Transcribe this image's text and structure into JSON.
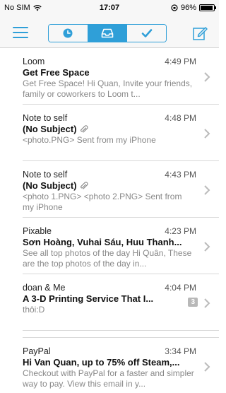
{
  "status": {
    "carrier": "No SIM",
    "time": "17:07",
    "battery": "96%",
    "battery_level": 0.96
  },
  "nav": {
    "tabs": [
      "clock-icon",
      "inbox-tray-icon",
      "checkmark-icon"
    ],
    "active_tab": 1
  },
  "emails": [
    {
      "sender": "Loom",
      "time": "4:49 PM",
      "subject": "Get Free Space",
      "preview": "Get Free Space! Hi Quan, Invite your friends, family or coworkers to Loom t...",
      "attachment": false,
      "count": ""
    },
    {
      "sender": "Note to self",
      "time": "4:48 PM",
      "subject": "(No Subject)",
      "preview": "<photo.PNG> Sent from my iPhone",
      "attachment": true,
      "count": ""
    },
    {
      "sender": "Note to self",
      "time": "4:43 PM",
      "subject": "(No Subject)",
      "preview": "<photo 1.PNG> <photo 2.PNG> Sent from my iPhone",
      "attachment": true,
      "count": ""
    },
    {
      "sender": "Pixable",
      "time": "4:23 PM",
      "subject": "Sơn Hoàng, Vuhai Sáu, Huu Thanh...",
      "preview": "See all top photos of the day Hi Quân, These are the top photos of the day in...",
      "attachment": false,
      "count": ""
    },
    {
      "sender": "doan & Me",
      "time": "4:04 PM",
      "subject": "A 3-D Printing Service That I...",
      "preview": "thôi:D",
      "attachment": false,
      "count": "3"
    },
    {
      "sender": "PayPal",
      "time": "3:34 PM",
      "subject": "Hi Van Quan, up to 75% off Steam,...",
      "preview": "Checkout with PayPal for a faster and simpler way to pay. View this email in y...",
      "attachment": false,
      "count": ""
    }
  ]
}
